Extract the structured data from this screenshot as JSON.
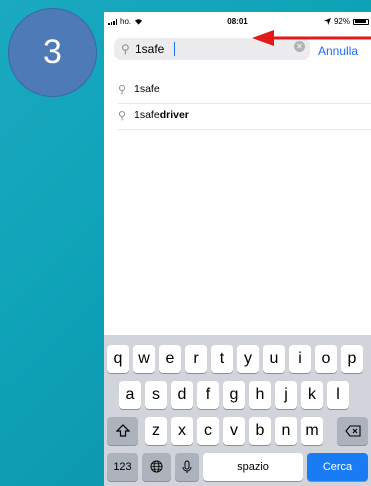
{
  "step_badge": {
    "number": "3"
  },
  "status_bar": {
    "carrier": "ho.",
    "time": "08:01",
    "battery": "92%"
  },
  "search": {
    "value": "1safe",
    "cancel_label": "Annulla"
  },
  "results": [
    {
      "prefix": "1safe",
      "suffix": ""
    },
    {
      "prefix": "1safe",
      "suffix": "driver"
    }
  ],
  "keyboard": {
    "row1": [
      "q",
      "w",
      "e",
      "r",
      "t",
      "y",
      "u",
      "i",
      "o",
      "p"
    ],
    "row2": [
      "a",
      "s",
      "d",
      "f",
      "g",
      "h",
      "j",
      "k",
      "l"
    ],
    "row3": [
      "z",
      "x",
      "c",
      "v",
      "b",
      "n",
      "m"
    ],
    "numbers_label": "123",
    "space_label": "spazio",
    "search_label": "Cerca"
  },
  "colors": {
    "accent": "#1d6ef5",
    "annotation_arrow": "#e01919",
    "badge": "#4f7ab8"
  }
}
